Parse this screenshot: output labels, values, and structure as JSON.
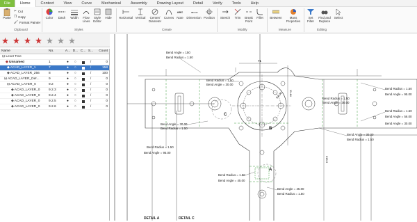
{
  "menu": [
    "File",
    "Home",
    "Context",
    "View",
    "Curve",
    "Mechanical",
    "Assembly",
    "Drawing Layout",
    "Detail",
    "Verify",
    "Tools",
    "Help"
  ],
  "clipboard": {
    "paste": "Paste",
    "cut": "Cut",
    "copy": "Copy",
    "format_painter": "Format Painter",
    "label": "Clipboard"
  },
  "styles": {
    "color": "Color",
    "dash": "Dash",
    "width": "Width",
    "flow_lines": "Flow Lines",
    "style_editor": "Style Editor",
    "hide": "Hide",
    "label": "Styles"
  },
  "create": {
    "horizontal": "Horizontal",
    "vertical": "Vertical",
    "center_diameter": "Center/ Diameter",
    "curves": "Curves",
    "note": "Note",
    "dimension": "Dimension",
    "position": "Position",
    "label": "Create"
  },
  "modify": {
    "stretch": "Stretch",
    "trim": "Trim",
    "break_point": "Break Point",
    "fillet": "Fillet",
    "label": "Modify"
  },
  "measure": {
    "between": "Between",
    "mass_properties": "Mass Properties",
    "label": "Measure"
  },
  "editing": {
    "set_filter": "Set Filter",
    "find_replace": "Find and Replace",
    "select": "Select",
    "label": "Editing"
  },
  "layers": {
    "headers": {
      "name": "Name",
      "no": "No.",
      "a": "A...",
      "d": "D...",
      "c": "C...",
      "s": "S...",
      "count": "Count"
    },
    "rows": [
      {
        "name": "Level Tree",
        "no": "",
        "count": ""
      },
      {
        "name": "Unnamed",
        "no": "1",
        "count": "0"
      },
      {
        "name": "ACAD_LAYER_1",
        "no": "7",
        "count": "158"
      },
      {
        "name": "ACAD_LAYER_256",
        "no": "8",
        "count": "100"
      },
      {
        "name": "ACAD_LAYER_Def...",
        "no": "9",
        "count": "0"
      },
      {
        "name": "ACAD_LAYER_0",
        "no": "9.2",
        "count": "0"
      },
      {
        "name": "ACAD_LAYER_0",
        "no": "9.2.3",
        "count": "0"
      },
      {
        "name": "ACAD_LAYER_0",
        "no": "9.2.4",
        "count": "0"
      },
      {
        "name": "ACAD_LAYER_0",
        "no": "9.2.5",
        "count": "0"
      },
      {
        "name": "ACAD_LAYER_0",
        "no": "9.2.6",
        "count": "0"
      }
    ]
  },
  "annotations": {
    "ba150_a": "Bend Angle = 150",
    "br150_a": "Bend Radius = 1.50",
    "br150_b": "Bend Radius = 1.50",
    "ba3000_a": "Bend Angle = 30.00",
    "ba3000_b": "Bend Angle = 30.00",
    "br150_c": "Bend Radius = 1.50",
    "ba3000_c": "Bend Angle = 30.00",
    "br150_d": "Bend Radius = 1.50",
    "br150_e": "Bend Radius = 1.50",
    "ba9500": "Bend Angle = 95.00",
    "br150_f": "Bend Radius = 1.50",
    "ba4500": "Bend Angle = 45.00",
    "ba4500_b": "Bend Angle = 45.00",
    "br150_g": "Bend Radius = 1.50",
    "br150_h": "Bend Radius = 1.50",
    "ba9500_b": "Bend Angle = 95.00",
    "br150_i": "Bend Radius = 1.50",
    "ba5600": "Bend Angle = 56.00",
    "ba3000_d": "Bend Angle = 30.00",
    "ba3000_e": "Bend Angle = 30.00",
    "br150_j": "Bend Radius = 1.50",
    "label_c": "C",
    "label_b": "B",
    "label_a": "A",
    "detail_a": "DETAIL A",
    "detail_c": "DETAIL C",
    "dim_top": "71",
    "dim_mid": "11.44",
    "dim_side": "219.3",
    "dim_r": "R4.00"
  },
  "colors": {
    "file_tab": "#7fbf3f",
    "selected_row": "#3a78c8",
    "ribbon_bg": "#fafafa"
  }
}
